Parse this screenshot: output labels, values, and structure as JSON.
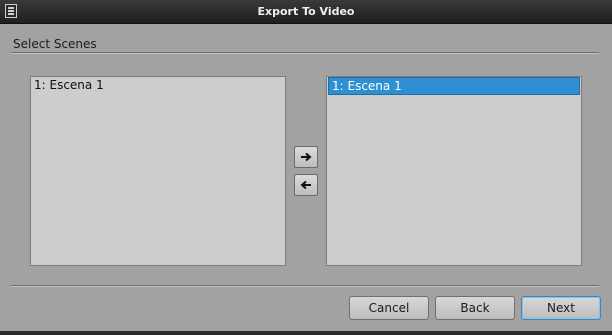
{
  "window": {
    "title": "Export To Video"
  },
  "section": {
    "label": "Select Scenes"
  },
  "available_scenes": [
    "1: Escena 1"
  ],
  "selected_scenes": [
    "1: Escena 1"
  ],
  "buttons": {
    "cancel": "Cancel",
    "back": "Back",
    "next": "Next"
  },
  "icons": {
    "app": "film-strip-icon",
    "add": "arrow-right-icon",
    "remove": "arrow-left-icon"
  },
  "colors": {
    "selection": "#2f8fd3",
    "titlebar": "#2a2a2a"
  }
}
